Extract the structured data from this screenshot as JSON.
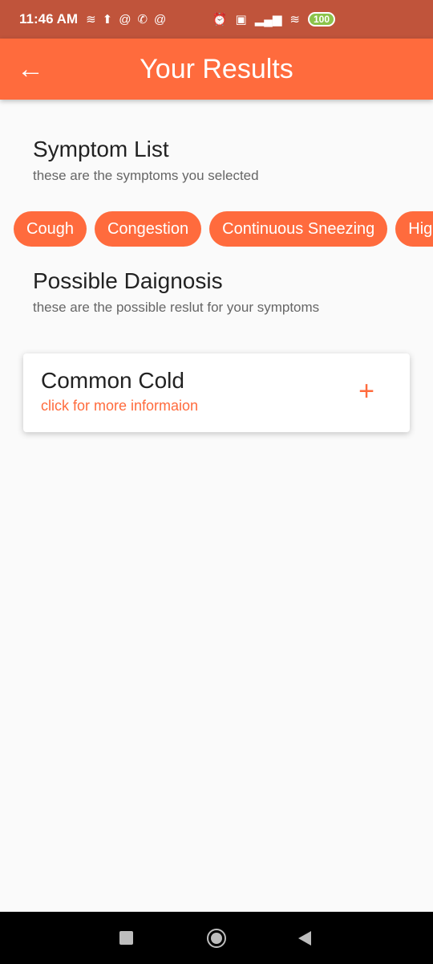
{
  "status_bar": {
    "time": "11:46 AM",
    "left_icons": [
      "wifi-signal-icon",
      "upload-icon",
      "at-icon",
      "phone-icon",
      "at-icon"
    ],
    "right_icons": [
      "alarm-icon",
      "volte-icon",
      "signal-4g-icon",
      "wifi-icon"
    ],
    "battery": "100"
  },
  "app_bar": {
    "title": "Your Results",
    "back_icon": "arrow-left-icon"
  },
  "symptoms": {
    "title": "Symptom List",
    "subtitle": "these are the symptoms you selected",
    "chips": [
      "Cough",
      "Congestion",
      "Continuous Sneezing",
      "High Fever"
    ]
  },
  "diagnosis": {
    "title": "Possible Daignosis",
    "subtitle": "these are the possible reslut for your symptoms",
    "cards": [
      {
        "title": "Common Cold",
        "subtitle": "click for more informaion",
        "icon": "plus-icon"
      }
    ]
  },
  "nav_bar": {
    "buttons": [
      "recent-apps-icon",
      "home-icon",
      "back-triangle-icon"
    ]
  },
  "colors": {
    "accent": "#ff6b3d",
    "status_bar": "#c0543b",
    "background": "#fafafa"
  }
}
